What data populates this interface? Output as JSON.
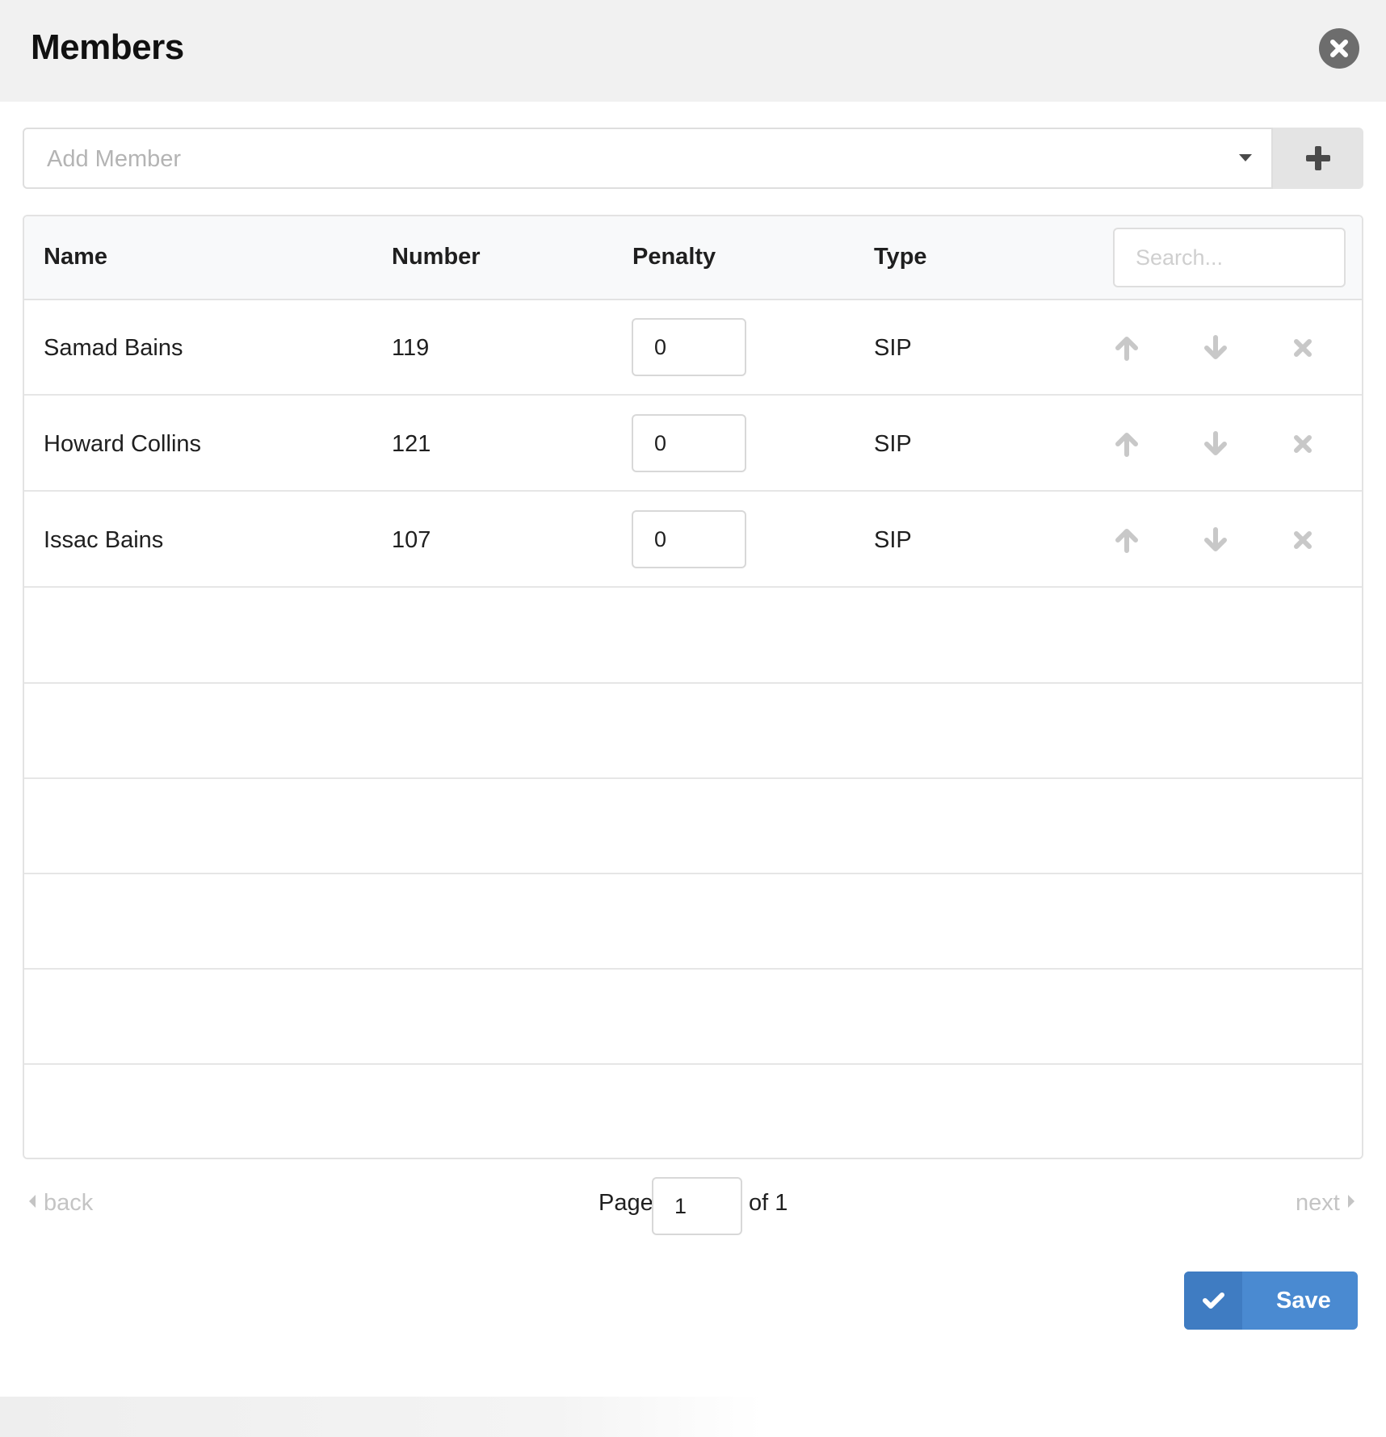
{
  "header": {
    "title": "Members"
  },
  "add_member": {
    "placeholder": "Add Member"
  },
  "table": {
    "columns": [
      "Name",
      "Number",
      "Penalty",
      "Type"
    ],
    "search_placeholder": "Search...",
    "rows": [
      {
        "name": "Samad Bains",
        "number": "119",
        "penalty": "0",
        "type": "SIP"
      },
      {
        "name": "Howard Collins",
        "number": "121",
        "penalty": "0",
        "type": "SIP"
      },
      {
        "name": "Issac Bains",
        "number": "107",
        "penalty": "0",
        "type": "SIP"
      }
    ],
    "row_actions": [
      "arrow-up-icon",
      "arrow-down-icon",
      "remove-icon"
    ]
  },
  "pagination": {
    "back_label": "back",
    "next_label": "next",
    "page_label": "Page",
    "current_page": "1",
    "of_label": "of 1"
  },
  "footer": {
    "save_label": "Save"
  },
  "colors": {
    "header_bg": "#f1f1f1",
    "primary": "#4a8ad1",
    "primary_dark": "#3f7cc2",
    "muted_icon": "#c8c8c8"
  }
}
